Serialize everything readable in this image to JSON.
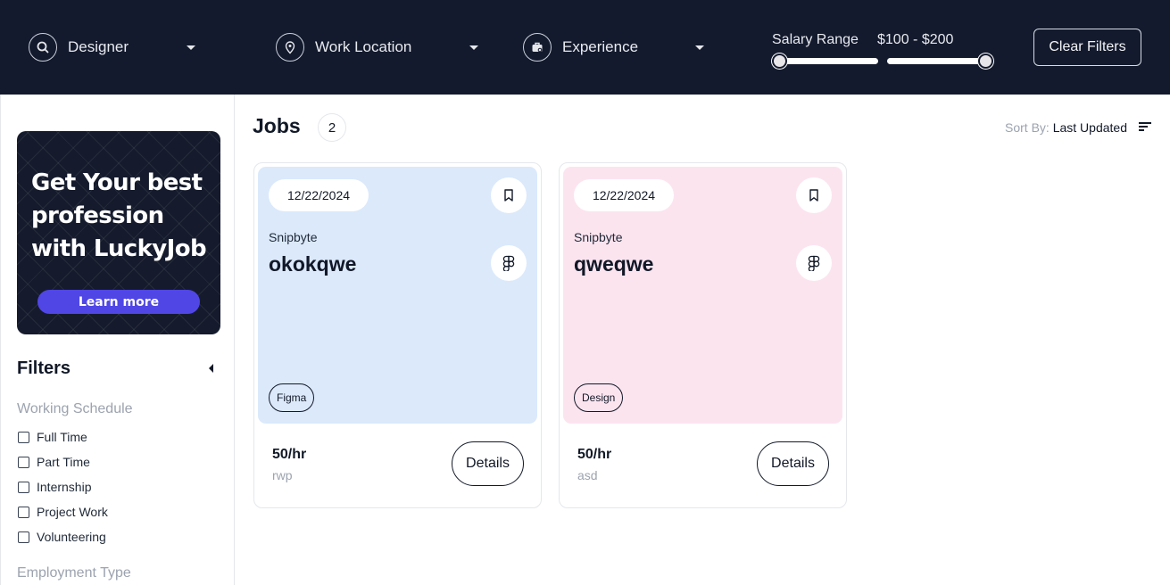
{
  "colors": {
    "topbar_bg": "#131a2d",
    "card1_bg": "#dbe9fb",
    "card2_bg": "#fce4ef",
    "promo_button": "#5046e5"
  },
  "topbar": {
    "filters": [
      {
        "label": "Designer",
        "icon": "search-icon"
      },
      {
        "label": "Work Location",
        "icon": "location-pin-icon"
      },
      {
        "label": "Experience",
        "icon": "briefcase-icon"
      }
    ],
    "salary": {
      "label": "Salary Range",
      "value": "$100 - $200",
      "low_fraction": 0.0,
      "high_fraction": 1.0
    },
    "clear_label": "Clear Filters"
  },
  "sidebar": {
    "promo": {
      "text": "Get Your best profession with LuckyJob",
      "button": "Learn more"
    },
    "filters_title": "Filters",
    "working_schedule": {
      "title": "Working Schedule",
      "options": [
        "Full Time",
        "Part Time",
        "Internship",
        "Project Work",
        "Volunteering"
      ]
    },
    "employment_type": {
      "title": "Employment Type"
    }
  },
  "main": {
    "title": "Jobs",
    "count": "2",
    "sort_label": "Sort By:",
    "sort_value": "Last Updated",
    "jobs": [
      {
        "date": "12/22/2024",
        "company": "Snipbyte",
        "title": "okokqwe",
        "tag": "Figma",
        "rate": "50/hr",
        "location": "rwp",
        "details": "Details",
        "icon": "figma-icon"
      },
      {
        "date": "12/22/2024",
        "company": "Snipbyte",
        "title": "qweqwe",
        "tag": "Design",
        "rate": "50/hr",
        "location": "asd",
        "details": "Details",
        "icon": "figma-icon"
      }
    ]
  }
}
